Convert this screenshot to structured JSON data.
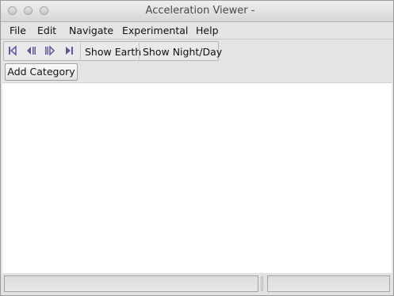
{
  "window": {
    "title": "Acceleration Viewer -"
  },
  "menu": [
    "File",
    "Edit",
    "Navigate",
    "Experimental",
    "Help"
  ],
  "toolbar": {
    "nav_icons": [
      "skip-to-start-icon",
      "step-back-icon",
      "step-forward-icon",
      "skip-to-end-icon"
    ],
    "show_earth_label": "Show Earth",
    "show_night_day_label": "Show Night/Day"
  },
  "category_bar": {
    "add_category_label": "Add Category"
  },
  "status": {
    "left_text": "",
    "right_text": ""
  },
  "colors": {
    "nav_icon": "#5a5a9c",
    "content_bg": "#ffffff"
  }
}
